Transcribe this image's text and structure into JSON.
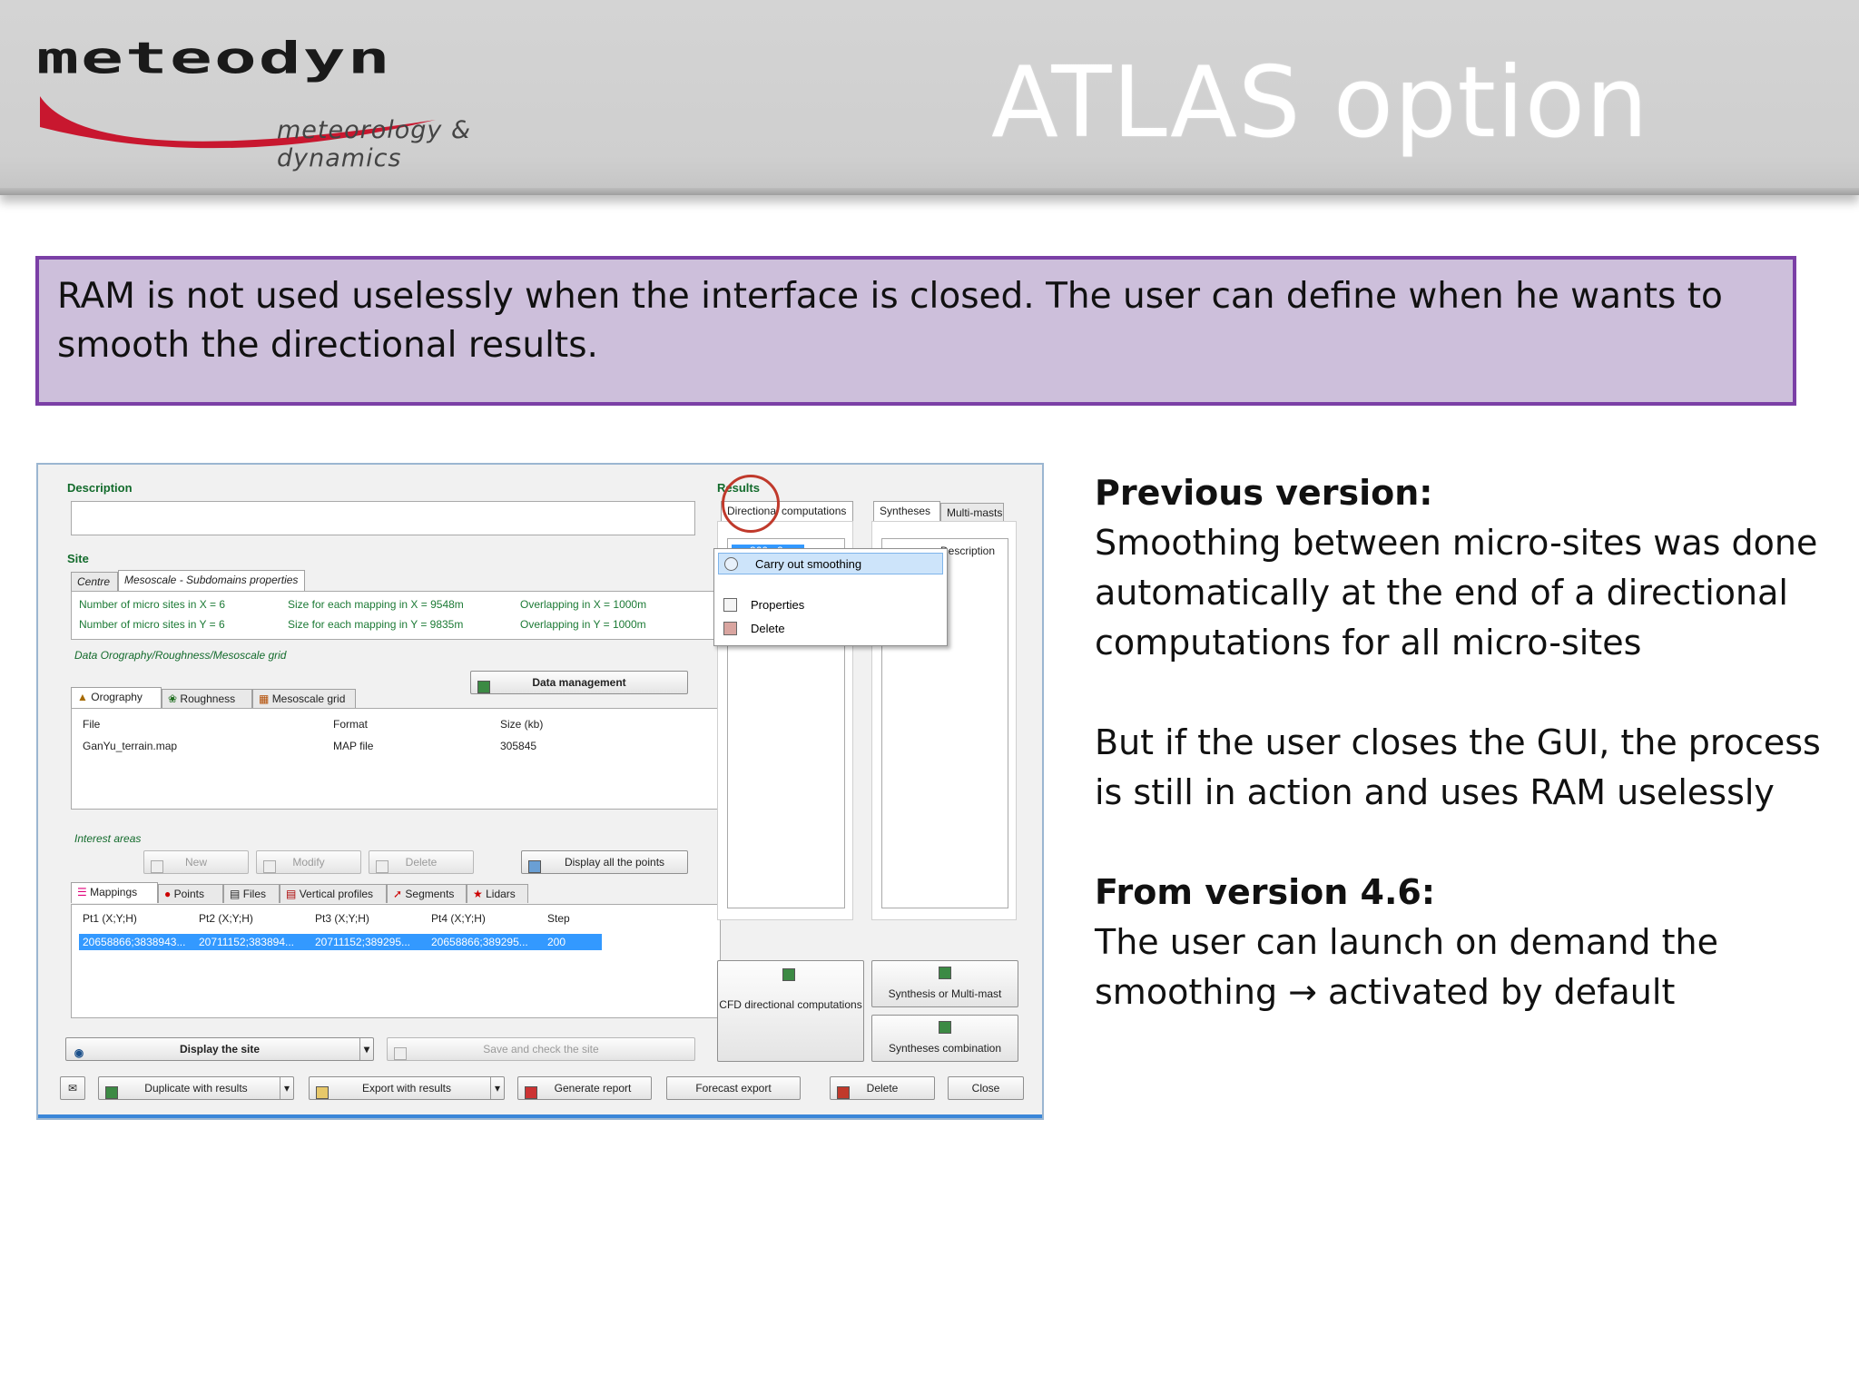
{
  "slide": {
    "logo_word": "meteodyn",
    "logo_tagline": "meteorology & dynamics",
    "title": "ATLAS option",
    "callout": "RAM is not used uselessly when the interface is closed. The user can define when he wants to smooth the directional results.",
    "notes": {
      "prev_heading": "Previous version:",
      "prev_lines": [
        "Smoothing between micro-sites was done",
        "automatically at the end of a directional",
        "computations for all micro-sites"
      ],
      "but_lines": [
        "But if the user closes the GUI, the process",
        "is still in action and uses RAM uselessly"
      ],
      "new_heading": "From version 4.6:",
      "new_lines": [
        "The user can launch on demand the",
        "smoothing → activated by default"
      ]
    }
  },
  "app": {
    "description_label": "Description",
    "site_label": "Site",
    "site_tabs": [
      "Centre",
      "Mesoscale - Subdomains properties"
    ],
    "site_info": {
      "nx": "Number of micro sites in X = 6",
      "ny": "Number of micro sites in Y = 6",
      "sx": "Size for each mapping in X = 9548m",
      "sy": "Size for each mapping in Y = 9835m",
      "ox": "Overlapping in X = 1000m",
      "oy": "Overlapping in Y = 1000m"
    },
    "data_label": "Data Orography/Roughness/Mesoscale grid",
    "data_mgmt_button": "Data management",
    "data_tabs": [
      "Orography",
      "Roughness",
      "Mesoscale grid"
    ],
    "data_table": {
      "headers": [
        "File",
        "Format",
        "Size (kb)"
      ],
      "rows": [
        [
          "GanYu_terrain.map",
          "MAP file",
          "305845"
        ]
      ]
    },
    "interest_label": "Interest areas",
    "interest_buttons": [
      "New",
      "Modify",
      "Delete",
      "Display all the points"
    ],
    "interest_tabs": [
      "Mappings",
      "Points",
      "Files",
      "Vertical profiles",
      "Segments",
      "Lidars"
    ],
    "interest_table": {
      "headers": [
        "Pt1 (X;Y;H)",
        "Pt2 (X;Y;H)",
        "Pt3 (X;Y;H)",
        "Pt4 (X;Y;H)",
        "Step"
      ],
      "rows": [
        [
          "20658866;3838943...",
          "20711152;383894...",
          "20711152;389295...",
          "20658866;389295...",
          "200"
        ]
      ]
    },
    "display_site": "Display the site",
    "save_check": "Save and check the site",
    "bottom_buttons": [
      "Duplicate with results",
      "Export with results",
      "Generate report",
      "Forecast export",
      "Delete",
      "Close"
    ],
    "results_label": "Results",
    "results_tabs": [
      "Directional computations",
      "Syntheses",
      "Multi-masts"
    ],
    "description_col": "Description",
    "tree_item": "360 _2",
    "context_menu": [
      "Carry out smoothing",
      "Properties",
      "Delete"
    ],
    "cfd_button": "CFD directional computations",
    "synthesis_button": "Synthesis or Multi-mast",
    "combination_button": "Syntheses combination"
  }
}
